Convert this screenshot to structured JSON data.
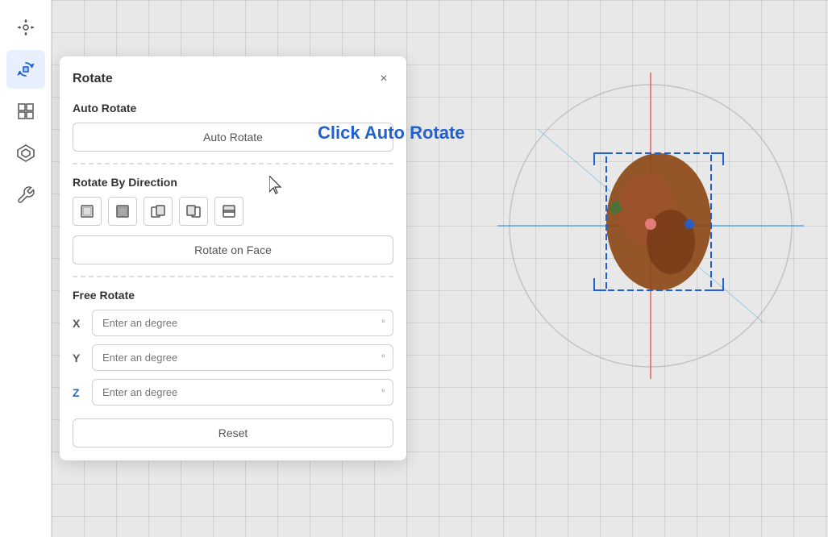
{
  "sidebar": {
    "items": [
      {
        "id": "transform",
        "icon": "transform-icon",
        "active": false
      },
      {
        "id": "rotate",
        "icon": "rotate-icon",
        "active": true
      },
      {
        "id": "view",
        "icon": "view-icon",
        "active": false
      },
      {
        "id": "build",
        "icon": "build-icon",
        "active": false
      },
      {
        "id": "tools",
        "icon": "tools-icon",
        "active": false
      }
    ]
  },
  "panel": {
    "title": "Rotate",
    "close_label": "×",
    "sections": {
      "auto_rotate": {
        "label": "Auto Rotate",
        "button_label": "Auto Rotate",
        "click_hint": "Click Auto Rotate"
      },
      "rotate_by_direction": {
        "label": "Rotate By Direction",
        "rotate_on_face_label": "Rotate on Face"
      },
      "free_rotate": {
        "label": "Free Rotate",
        "x_label": "X",
        "y_label": "Y",
        "z_label": "Z",
        "placeholder": "Enter an degree",
        "degree_symbol": "°",
        "reset_label": "Reset"
      }
    }
  }
}
